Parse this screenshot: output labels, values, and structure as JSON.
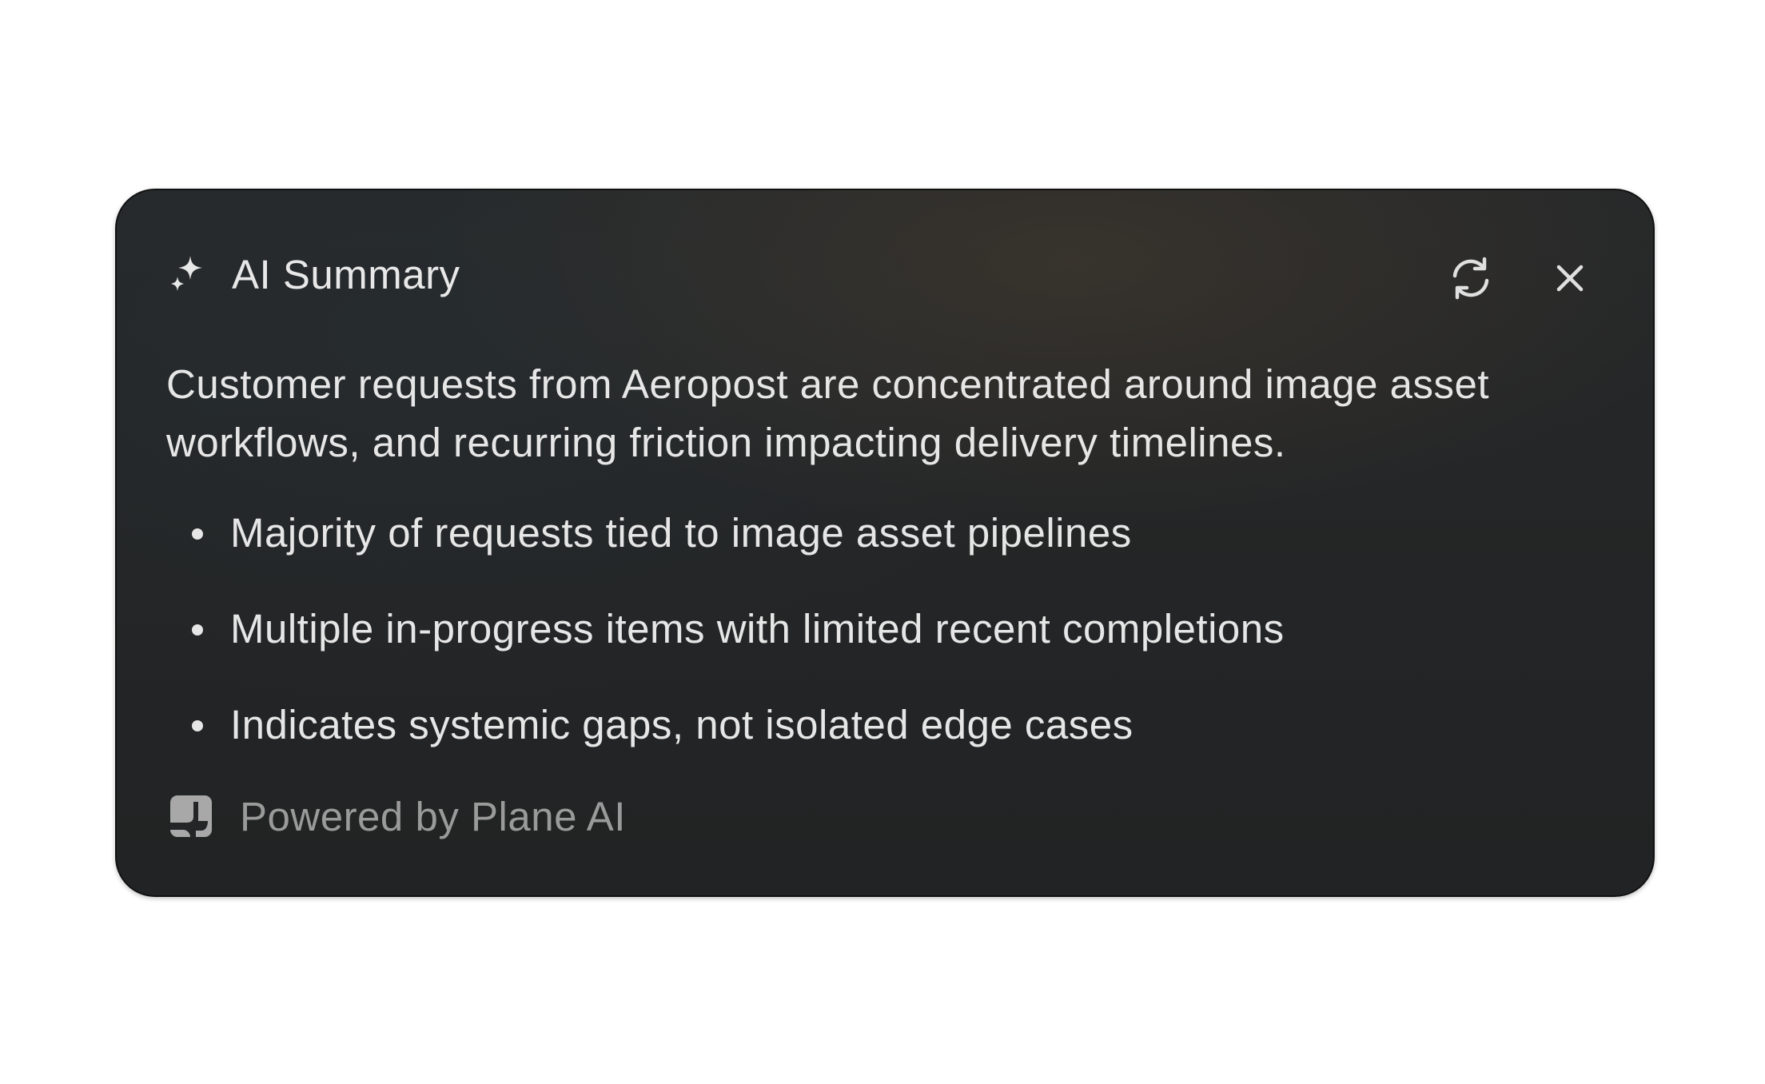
{
  "panel": {
    "title": "AI Summary",
    "title_icon": "sparkle-icon",
    "actions": {
      "refresh_icon": "refresh-icon",
      "close_icon": "close-icon"
    }
  },
  "summary": {
    "text": "Customer requests from Aeropost are concentrated around image asset workflows, and recurring friction impacting delivery timelines.",
    "bullets": [
      "Majority of requests tied to image asset pipelines",
      "Multiple in-progress items with limited recent completions",
      "Indicates systemic gaps, not isolated edge cases"
    ]
  },
  "footer": {
    "icon": "plane-logo-icon",
    "text": "Powered by Plane AI"
  },
  "colors": {
    "card_background": "#242526",
    "text_primary": "#e6e6e6",
    "text_muted": "#9a9a9a",
    "page_background": "#ffffff"
  }
}
